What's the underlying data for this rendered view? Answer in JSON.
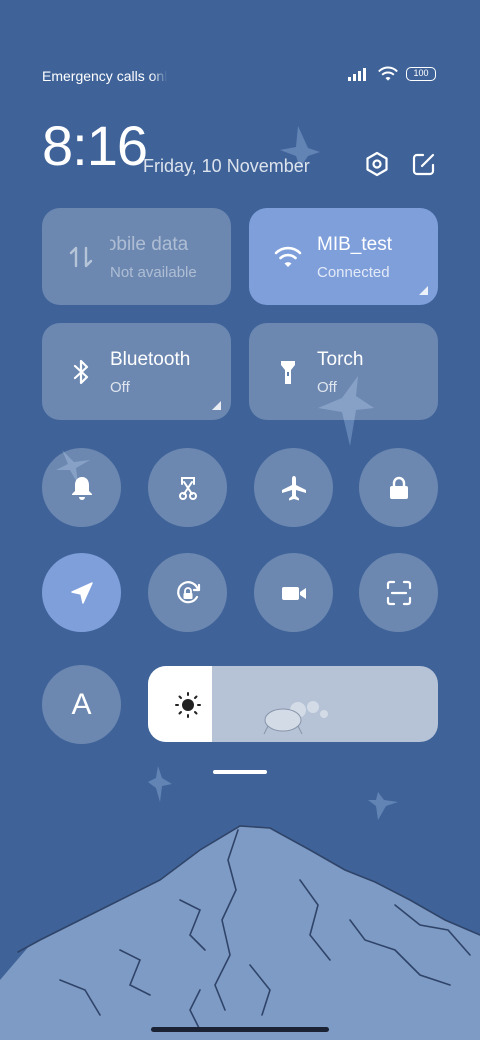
{
  "status_bar": {
    "carrier_text": "Emergency calls only",
    "battery_level": "100",
    "icons": [
      "signal-icon",
      "wifi-icon",
      "battery-icon"
    ]
  },
  "header": {
    "time": "8:16",
    "date": "Friday, 10 November",
    "settings_icon": "settings-hexagon-icon",
    "edit_icon": "edit-icon"
  },
  "tiles": [
    {
      "id": "mobile-data",
      "title": "Mobile data",
      "subtitle": "Not available",
      "icon": "mobile-data-icon",
      "state": "disabled"
    },
    {
      "id": "wifi",
      "title": "MIB_test",
      "subtitle": "Connected",
      "icon": "wifi-icon",
      "state": "on"
    },
    {
      "id": "bluetooth",
      "title": "Bluetooth",
      "subtitle": "Off",
      "icon": "bluetooth-icon",
      "state": "off"
    },
    {
      "id": "torch",
      "title": "Torch",
      "subtitle": "Off",
      "icon": "torch-icon",
      "state": "off"
    }
  ],
  "toggles": [
    {
      "id": "ring",
      "icon": "bell-icon",
      "state": "off"
    },
    {
      "id": "screenshot",
      "icon": "scissors-icon",
      "state": "off"
    },
    {
      "id": "airplane",
      "icon": "airplane-icon",
      "state": "off"
    },
    {
      "id": "lock",
      "icon": "lock-icon",
      "state": "off"
    },
    {
      "id": "location",
      "icon": "location-arrow-icon",
      "state": "on"
    },
    {
      "id": "rotation-lock",
      "icon": "rotation-lock-icon",
      "state": "off"
    },
    {
      "id": "screen-recorder",
      "icon": "video-camera-icon",
      "state": "off"
    },
    {
      "id": "scanner",
      "icon": "scan-icon",
      "state": "off"
    },
    {
      "id": "font",
      "label": "A",
      "icon": "font-icon",
      "state": "off"
    }
  ],
  "brightness": {
    "level": 0.22,
    "icon": "sun-icon"
  },
  "colors": {
    "background": "#3f6399",
    "tile": "#5e7fae",
    "active": "#7f9fdb",
    "mountain": "#7e9bc5"
  }
}
